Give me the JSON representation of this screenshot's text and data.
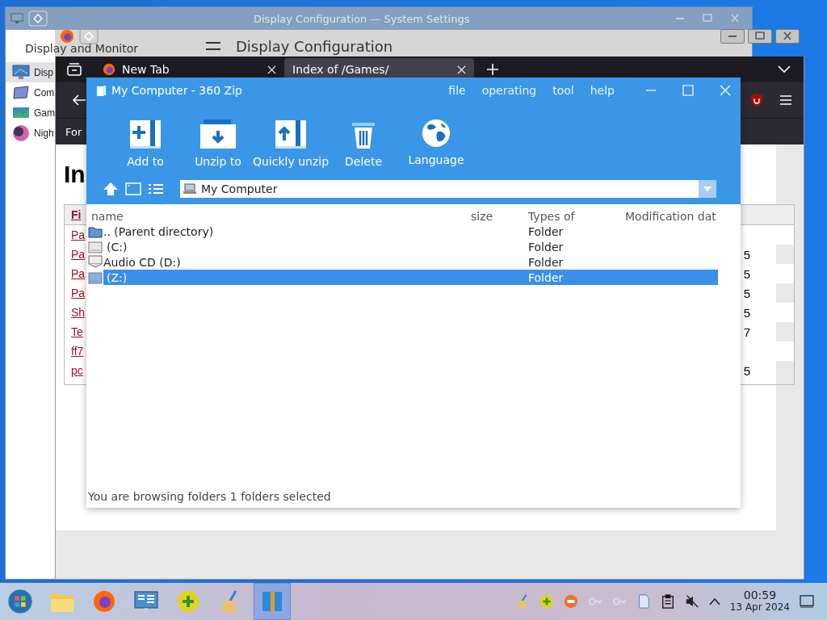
{
  "settings_window": {
    "title": "Display Configuration — System Settings",
    "back_label": "Display and Monitor",
    "page_title": "Display Configuration",
    "sidebar": {
      "items": [
        {
          "label": "Disp",
          "kind": "display",
          "selected": true
        },
        {
          "label": "Com",
          "kind": "compositor",
          "selected": false
        },
        {
          "label": "Gam",
          "kind": "gamma",
          "selected": false
        },
        {
          "label": "Nigh",
          "kind": "night",
          "selected": false
        }
      ]
    }
  },
  "browser": {
    "tabs": [
      {
        "label": "New Tab",
        "selected": false
      },
      {
        "label": "Index of /Games/",
        "selected": true
      }
    ],
    "bookmark": "For",
    "page_heading": "In",
    "table": {
      "header": "Fi",
      "rows": [
        {
          "name": "Pa",
          "column_2": ""
        },
        {
          "name": "Pa",
          "column_2": "5"
        },
        {
          "name": "Pa",
          "column_2": "5"
        },
        {
          "name": "Pa",
          "column_2": "5"
        },
        {
          "name": "Sh",
          "column_2": "5"
        },
        {
          "name": "Te",
          "column_2": "7"
        },
        {
          "name": "ff7",
          "column_2": ""
        },
        {
          "name": "pc",
          "column_2": "5"
        }
      ]
    }
  },
  "zip_window": {
    "title": "My Computer - 360 Zip",
    "menu": [
      "file",
      "operating",
      "tool",
      "help"
    ],
    "toolbar": [
      {
        "label": "Add to",
        "kind": "add"
      },
      {
        "label": "Unzip to",
        "kind": "unzip"
      },
      {
        "label": "Quickly unzip",
        "kind": "quick"
      },
      {
        "label": "Delete",
        "kind": "delete"
      },
      {
        "label": "Language",
        "kind": "language"
      }
    ],
    "path": "My Computer",
    "columns": [
      "name",
      "size",
      "Types of",
      "Modification dat"
    ],
    "rows": [
      {
        "name": ".. (Parent directory)",
        "type": "Folder",
        "kind": "folder",
        "selected": false
      },
      {
        "name": "(C:)",
        "type": "Folder",
        "kind": "drive",
        "selected": false
      },
      {
        "name": "Audio CD (D:)",
        "type": "Folder",
        "kind": "cd",
        "selected": false
      },
      {
        "name": "(Z:)",
        "type": "Folder",
        "kind": "drive",
        "selected": true
      }
    ],
    "status": "You are browsing folders 1 folders selected"
  },
  "taskbar": {
    "apps": [
      {
        "kind": "folder",
        "selected": false
      },
      {
        "kind": "firefox",
        "selected": false
      },
      {
        "kind": "control",
        "selected": false
      },
      {
        "kind": "plus",
        "selected": false
      },
      {
        "kind": "broom",
        "selected": false
      },
      {
        "kind": "zip",
        "selected": true
      }
    ],
    "time": "00:59",
    "date": "13 Apr 2024"
  }
}
